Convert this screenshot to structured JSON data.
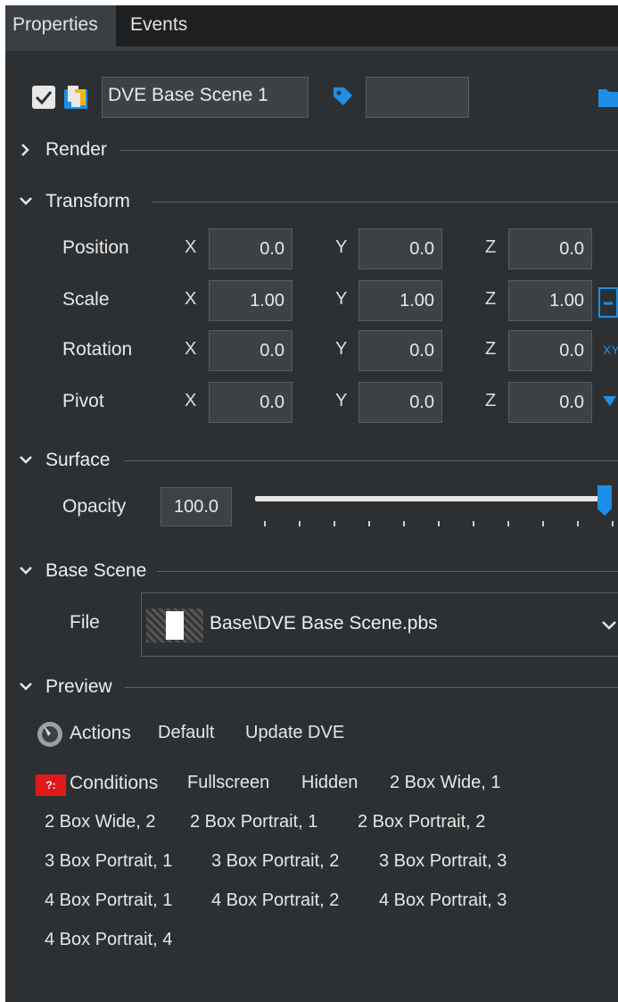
{
  "tabs": [
    {
      "label": "Properties",
      "active": true
    },
    {
      "label": "Events",
      "active": false
    }
  ],
  "object": {
    "enabled": true,
    "name": "DVE Base Scene 1",
    "tag_value": ""
  },
  "sections": {
    "render": "Render",
    "transform": "Transform",
    "surface": "Surface",
    "base_scene": "Base Scene",
    "preview": "Preview"
  },
  "transform": {
    "axis_x": "X",
    "axis_y": "Y",
    "axis_z": "Z",
    "rows": [
      {
        "label": "Position",
        "x": "0.0",
        "y": "0.0",
        "z": "0.0"
      },
      {
        "label": "Scale",
        "x": "1.00",
        "y": "1.00",
        "z": "1.00"
      },
      {
        "label": "Rotation",
        "x": "0.0",
        "y": "0.0",
        "z": "0.0"
      },
      {
        "label": "Pivot",
        "x": "0.0",
        "y": "0.0",
        "z": "0.0"
      }
    ],
    "rotation_side_label": "XY"
  },
  "surface": {
    "opacity_label": "Opacity",
    "opacity_value": "100.0",
    "opacity_fraction": 1.0
  },
  "base_scene": {
    "file_label": "File",
    "file_value": "Base\\DVE Base Scene.pbs"
  },
  "preview": {
    "actions": {
      "label": "Actions",
      "items": [
        "Default",
        "Update DVE"
      ]
    },
    "conditions": {
      "badge": "?:",
      "label": "Conditions",
      "items": [
        "Fullscreen",
        "Hidden",
        "2 Box Wide, 1",
        "2 Box Wide, 2",
        "2 Box Portrait, 1",
        "2 Box Portrait, 2",
        "3 Box Portrait, 1",
        "3 Box Portrait, 2",
        "3 Box Portrait, 3",
        "4 Box Portrait, 1",
        "4 Box Portrait, 2",
        "4 Box Portrait, 3",
        "4 Box Portrait, 4"
      ]
    }
  },
  "colors": {
    "panel_bg": "#2d3033",
    "field_bg": "#3d4246",
    "accent_blue": "#1e8fe6",
    "badge_red": "#e0191b"
  }
}
